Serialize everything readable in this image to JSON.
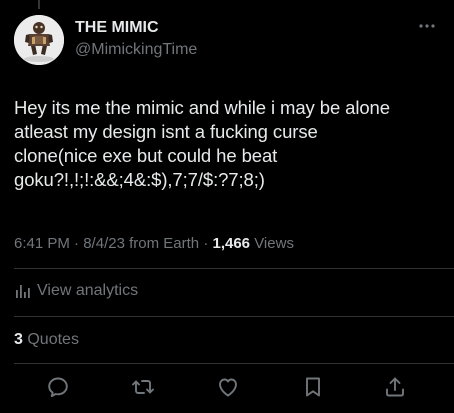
{
  "tweet": {
    "author": {
      "display_name": "THE MIMIC",
      "handle": "@MimickingTime",
      "avatar_icon": "figure-avatar"
    },
    "text": "Hey its me the mimic and while i may be alone\natleast my design isnt a fucking curse\nclone(nice exe but could he beat\ngoku?!,!;!:&&;4&:$),7;7/$:?7;8;)",
    "time": "6:41 PM",
    "date": "8/4/23",
    "source": "from Earth",
    "separator": "·",
    "views_count": "1,466",
    "views_label": "Views",
    "analytics_label": "View analytics",
    "quotes_count": "3",
    "quotes_label": "Quotes"
  },
  "actions": [
    {
      "name": "reply",
      "icon": "reply-icon"
    },
    {
      "name": "retweet",
      "icon": "retweet-icon"
    },
    {
      "name": "like",
      "icon": "heart-icon"
    },
    {
      "name": "bookmark",
      "icon": "bookmark-icon"
    },
    {
      "name": "share",
      "icon": "share-icon"
    }
  ],
  "colors": {
    "background": "#000000",
    "primary_text": "#e7e9ea",
    "secondary_text": "#71767b",
    "divider": "#2f3336"
  }
}
